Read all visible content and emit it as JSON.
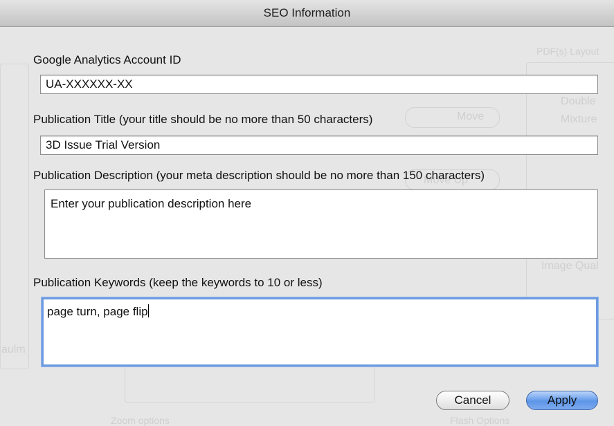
{
  "dialog": {
    "title": "SEO Information",
    "ga": {
      "label": "Google Analytics Account ID",
      "value": "UA-XXXXXX-XX"
    },
    "pub_title": {
      "label": "Publication Title (your title should be no more than 50 characters)",
      "value": "3D Issue Trial Version"
    },
    "pub_desc": {
      "label": "Publication Description (your meta description should be no more than 150 characters)",
      "value": "Enter your publication description here"
    },
    "keywords": {
      "label": "Publication Keywords (keep the keywords to 10 or less)",
      "value": "page turn, page flip"
    },
    "buttons": {
      "cancel": "Cancel",
      "apply": "Apply"
    }
  },
  "background_window": {
    "pdf_layout_label": "PDF(s) Layout",
    "move_label": "Move",
    "move_up_label": "Move Up",
    "double_label": "Double",
    "mixture_label": "Mixture",
    "image_quality_label": "Image Qual",
    "zoom_options_label": "Zoom options",
    "flash_options_label": "Flash Options",
    "left_text": "aulm"
  },
  "colors": {
    "focus_ring": "#6f9be0",
    "apply_button": "#5d96e8"
  }
}
